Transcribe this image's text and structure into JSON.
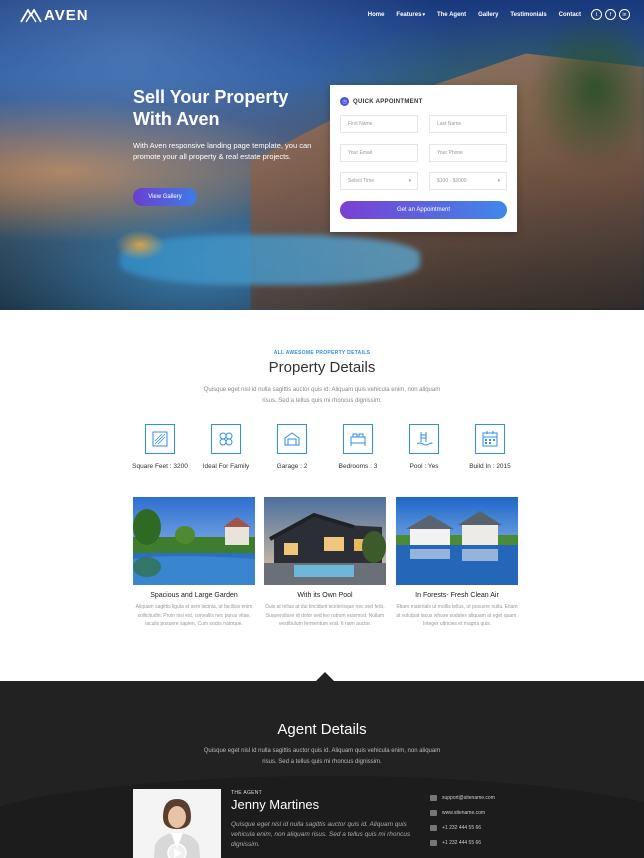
{
  "brand": {
    "name": "AVEN"
  },
  "nav": {
    "items": [
      {
        "label": "Home"
      },
      {
        "label": "Features",
        "has_dropdown": true
      },
      {
        "label": "The Agent"
      },
      {
        "label": "Gallery"
      },
      {
        "label": "Testimonials"
      },
      {
        "label": "Contact"
      }
    ],
    "social": [
      {
        "icon": "twitter-icon",
        "glyph": "t"
      },
      {
        "icon": "facebook-icon",
        "glyph": "f"
      },
      {
        "icon": "linkedin-icon",
        "glyph": "in"
      }
    ]
  },
  "hero": {
    "title_line1": "Sell Your Property",
    "title_line2": "With Aven",
    "subtitle": "With Aven responsive landing page template, you can promote your all property & real estate projects.",
    "cta_label": "View Gallery"
  },
  "appointment": {
    "title": "QUICK APPOINTMENT",
    "first_name_placeholder": "First Name",
    "last_name_placeholder": "Last Name",
    "email_placeholder": "Your Email",
    "phone_placeholder": "Your Phone",
    "time_select": "Select Time",
    "price_select": "$100 - $2000",
    "submit_label": "Get an Appointment"
  },
  "property": {
    "kicker": "ALL AWESOME PROPERTY DETAILS",
    "title": "Property Details",
    "description": "Quisque eget nisl id nulla sagittis auctor quis id. Aliquam quis vehicula enim, non aliquam risus. Sed a tellus quis mi rhoncus dignissim.",
    "features": [
      {
        "icon": "ruler-icon",
        "label": "Square Feet : 3200"
      },
      {
        "icon": "garden-icon",
        "label": "Ideal For Family"
      },
      {
        "icon": "garage-icon",
        "label": "Garage : 2"
      },
      {
        "icon": "bed-icon",
        "label": "Bedrooms : 3"
      },
      {
        "icon": "pool-icon",
        "label": "Pool : Yes"
      },
      {
        "icon": "calendar-icon",
        "label": "Build In : 2015"
      }
    ],
    "cards": [
      {
        "title": "Spacious and Large Garden",
        "text": "Aliquam sagittis ligula et sem lacinia, ut facilisis enim sollicitudin. Proin nisi est, convallis nec purus vitae, iaculis posuere sapien. Cum sociis natoque."
      },
      {
        "title": "With its Own Pool",
        "text": "Duis at tellus at dui tincidunt scelerisque nec sed felis. Suspendisse id dolor sed leo rutrum euismod. Nullam vestibulum fermentum erat. It nam auctor."
      },
      {
        "title": "In Forests- Fresh Clean Air",
        "text": "Etiam materials ut mollis tellus, ut posuere nulla. Etiam at volutpat lacus whose sodales aliquam at eget quam. Integer ultricies et magna quis."
      }
    ]
  },
  "agent": {
    "title": "Agent Details",
    "description": "Quisque eget nisl id nulla sagittis auctor quis id. Aliquam quis vehicula enim, non aliquam risus. Sed a tellus quis mi rhoncus dignissim.",
    "kicker": "THE AGENT",
    "name": "Jenny Martines",
    "quote": "Quisque eget nisl id nulla sagittis auctor quis id. Aliquam quis vehicula enim, non aliquam risus. Sed a tellus quis mi rhoncus dignissim.",
    "contacts": [
      {
        "icon": "email-icon",
        "value": "support@sitename.com"
      },
      {
        "icon": "globe-icon",
        "value": "www.sitename.com"
      },
      {
        "icon": "phone-icon",
        "value": "+1 232 444 55 66"
      },
      {
        "icon": "phone-icon",
        "value": "+1 232 444 55 66"
      }
    ]
  }
}
